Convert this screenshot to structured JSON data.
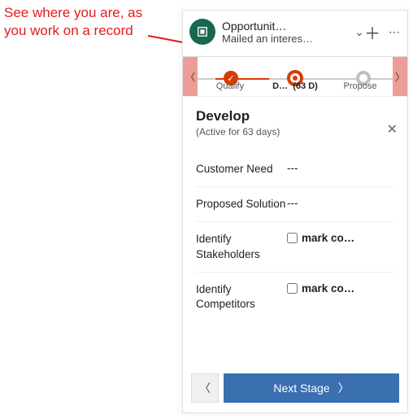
{
  "annotation": "See where you are, as you work on a record",
  "header": {
    "title": "Opportunit…",
    "subtitle": "Mailed an interes…"
  },
  "stages": {
    "s1": "Qualify",
    "s2_prefix": "D…",
    "s2_days": "(63 D)",
    "s3": "Propose"
  },
  "develop": {
    "title": "Develop",
    "subtitle": "(Active for 63 days)",
    "fields": {
      "customer_need_label": "Customer Need",
      "customer_need_value": "---",
      "proposed_solution_label": "Proposed Solution",
      "proposed_solution_value": "---",
      "identify_stakeholders_label": "Identify Stakeholders",
      "identify_competitors_label": "Identify Competitors",
      "mark_complete": "mark co…"
    }
  },
  "footer": {
    "next": "Next Stage"
  }
}
